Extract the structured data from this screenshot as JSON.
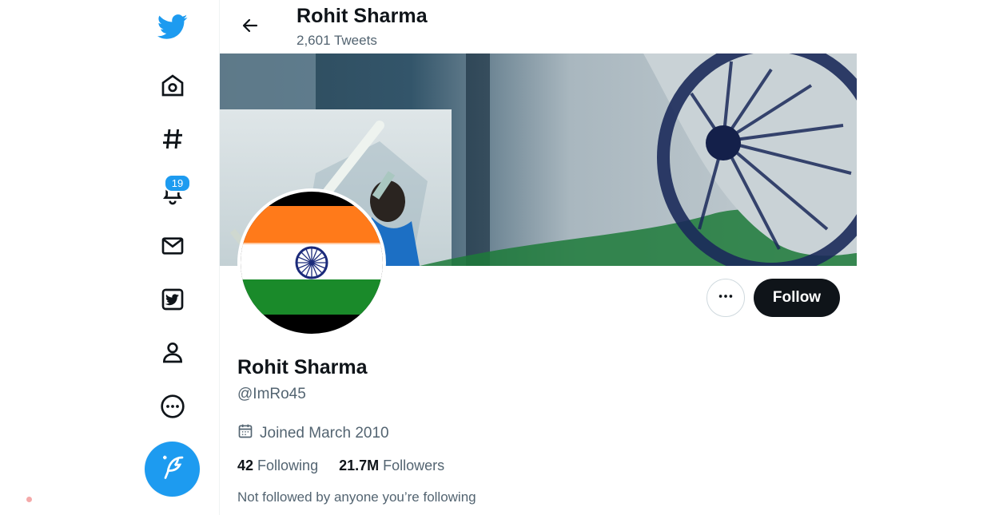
{
  "sidebar": {
    "icons": [
      "twitter-logo-icon",
      "home-icon",
      "explore-hashtag-icon",
      "notifications-bell-icon",
      "messages-mail-icon",
      "twitter-blue-icon",
      "profile-icon",
      "more-circle-icon"
    ],
    "notifications_badge": "19",
    "compose_icon": "compose-feather-icon"
  },
  "header": {
    "title": "Rohit Sharma",
    "tweet_count": "2,601 Tweets"
  },
  "profile": {
    "name": "Rohit Sharma",
    "handle": "@ImRo45",
    "joined": "Joined March 2010",
    "following_count": "42",
    "following_label": "Following",
    "followers_count": "21.7M",
    "followers_label": "Followers",
    "followed_note": "Not followed by anyone you’re following"
  },
  "actions": {
    "follow_label": "Follow",
    "more_icon": "more-horizontal-icon"
  },
  "colors": {
    "accent": "#1d9bf0",
    "text": "#0f1419",
    "secondary": "#536471",
    "saffron": "#ff7a1a",
    "green": "#1a8a2a",
    "chakra": "#1b2a7a"
  }
}
